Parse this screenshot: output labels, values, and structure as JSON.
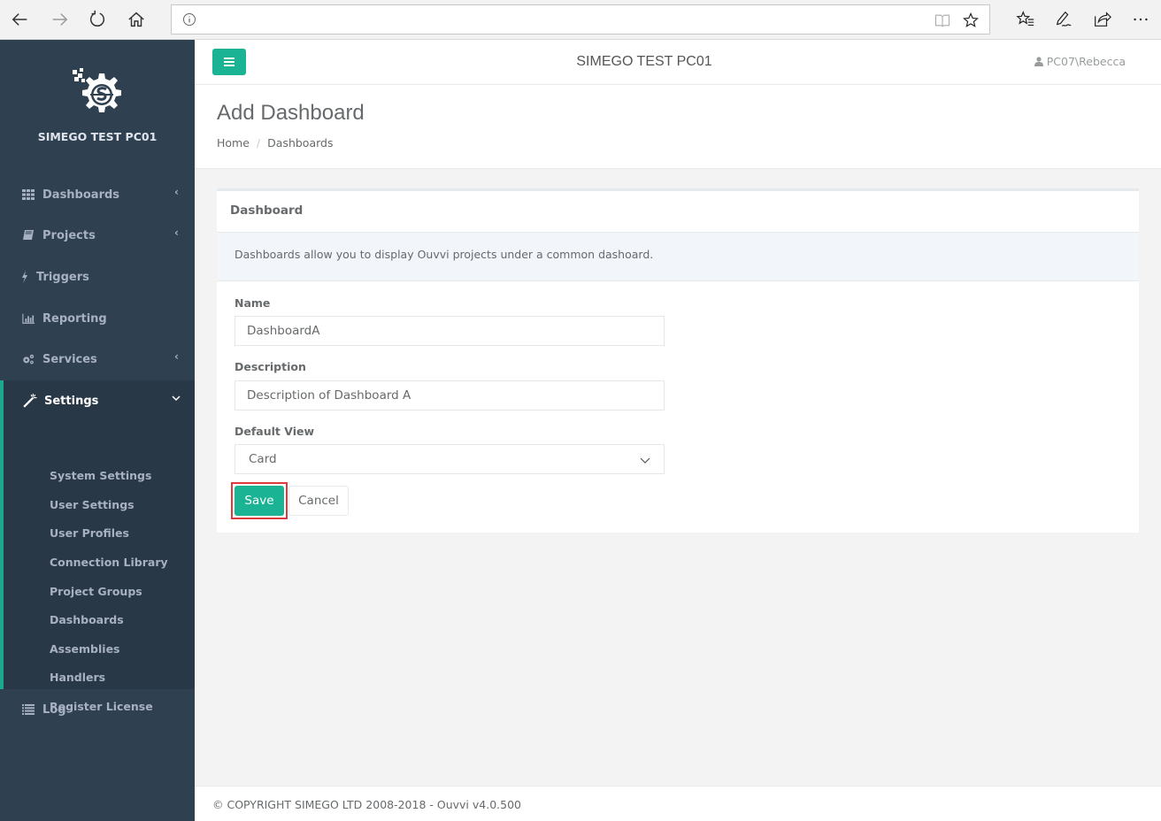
{
  "browser": {
    "address_value": "",
    "icons": [
      "back-icon",
      "forward-icon",
      "refresh-icon",
      "home-icon",
      "info-icon",
      "reading-view-icon",
      "favorite-star-icon",
      "favorites-list-icon",
      "pen-icon",
      "share-icon",
      "more-icon"
    ]
  },
  "sidebar": {
    "brand": "SIMEGO TEST PC01",
    "items": [
      {
        "label": "Dashboards",
        "icon": "grid-icon",
        "arrow": "‹"
      },
      {
        "label": "Projects",
        "icon": "book-icon",
        "arrow": "‹"
      },
      {
        "label": "Triggers",
        "icon": "bolt-icon",
        "arrow": ""
      },
      {
        "label": "Reporting",
        "icon": "bar-chart-icon",
        "arrow": ""
      },
      {
        "label": "Services",
        "icon": "gears-icon",
        "arrow": "‹"
      },
      {
        "label": "Settings",
        "icon": "magic-wand-icon",
        "arrow": "⌄"
      },
      {
        "label": "Log",
        "icon": "list-icon",
        "arrow": ""
      }
    ],
    "settings_subitems": [
      "System Settings",
      "User Settings",
      "User Profiles",
      "Connection Library",
      "Project Groups",
      "Dashboards",
      "Assemblies",
      "Handlers",
      "Register License"
    ]
  },
  "header": {
    "site_name": "SIMEGO TEST PC01",
    "user": "PC07\\Rebecca"
  },
  "page": {
    "title": "Add Dashboard",
    "breadcrumb": [
      "Home",
      "Dashboards"
    ],
    "breadcrumb_separator": "/"
  },
  "card": {
    "title": "Dashboard",
    "info": "Dashboards allow you to display Ouvvi projects under a common dashoard.",
    "fields": {
      "name_label": "Name",
      "name_value": "DashboardA",
      "description_label": "Description",
      "description_value": "Description of Dashboard A",
      "default_view_label": "Default View",
      "default_view_value": "Card"
    },
    "save_label": "Save",
    "cancel_label": "Cancel"
  },
  "footer": {
    "text": "© COPYRIGHT SIMEGO LTD 2008-2018 - Ouvvi v4.0.500"
  },
  "colors": {
    "accent": "#1ab394",
    "sidebar_bg": "#2f4050",
    "sidebar_active_bg": "#293846",
    "highlight_outline": "#e0393e"
  }
}
